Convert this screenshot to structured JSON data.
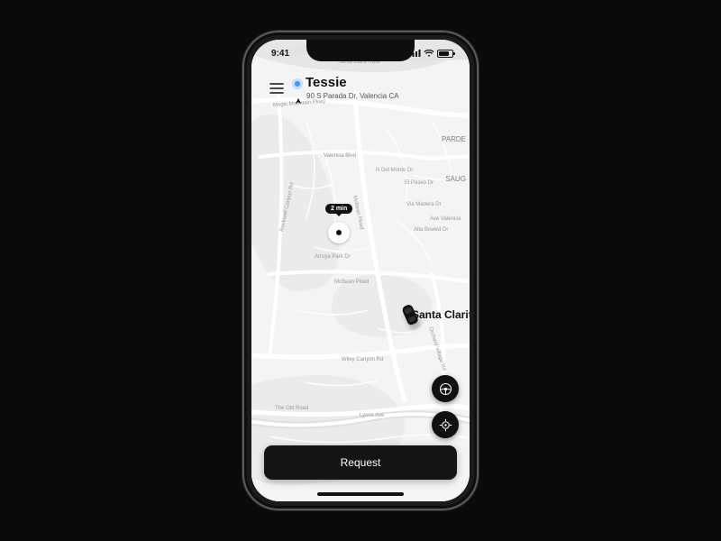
{
  "statusbar": {
    "time": "9:41"
  },
  "header": {
    "dest_name": "Tessie",
    "dest_addr": "90 S Parada Dr, Valencia CA"
  },
  "eta": {
    "label": "2 min"
  },
  "map_labels": {
    "river": "Santa Clara River",
    "city": "Santa Clarita",
    "parde": "PARDE",
    "saug": "SAUG",
    "roads": {
      "magic_mtn": "Magic Mountain Pkwy",
      "valencia": "Valencia Blvd",
      "mcbean": "McBean Pkwd",
      "mcbean2": "McBean Pkwd",
      "arroyo": "Arroya Park Dr",
      "wiley": "Wiley Canyon Rd",
      "orchard": "Orchard Village Rd",
      "old_road": "The Old Road",
      "lyons": "Lyons Ave",
      "rockwell": "Rockwell Canyon Rd",
      "delmonte": "N Del Monte Dr",
      "elpaseo": "El Paseo Dr",
      "ave_valencia": "Ave Valencia",
      "madera": "Via Madera Dr",
      "bowed": "Alta Bowed Dr"
    }
  },
  "actions": {
    "request": "Request"
  }
}
